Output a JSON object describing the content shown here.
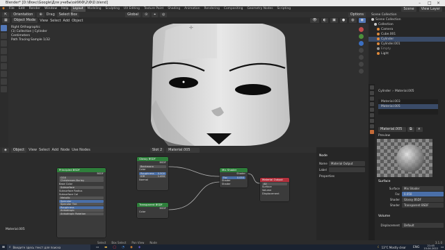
{
  "window": {
    "title": "Blender* [D:\\Фокс\\Google\\Для учебы\\ой96Ф\\2\\Ф\\D.blend]"
  },
  "menu": {
    "items": [
      "File",
      "Edit",
      "Render",
      "Window",
      "Help"
    ],
    "tabs": [
      "Layout",
      "Modeling",
      "Sculpting",
      "UV Editing",
      "Texture Paint",
      "Shading",
      "Animation",
      "Rendering",
      "Compositing",
      "Geometry Nodes",
      "Scripting"
    ],
    "active_tab": "Layout",
    "scene_label": "Scene",
    "view_layer_label": "View Layer"
  },
  "toolbar": {
    "mode": "Object Mode",
    "view": "View",
    "select": "Select",
    "add": "Add",
    "object": "Object",
    "orientation": "Orientation",
    "drag": "Drag",
    "select_box": "Select Box",
    "global": "Global",
    "options": "Options"
  },
  "viewport": {
    "info_lines": [
      "Right Orthographic",
      "(1) Collection | Cylinder",
      "Centimeters",
      "Path Tracing Sample 1/32"
    ]
  },
  "outliner": {
    "header": "Scene Collection",
    "items": [
      {
        "label": "Scene Collection",
        "color": "#cccccc"
      },
      {
        "label": "Collection",
        "color": "#cccccc"
      },
      {
        "label": "Camera",
        "color": "#e08b3c"
      },
      {
        "label": "Cube.001",
        "color": "#e08b3c"
      },
      {
        "label": "Cylinder",
        "color": "#e08b3c"
      },
      {
        "label": "Cylinder.001",
        "color": "#e08b3c"
      },
      {
        "label": "Empty",
        "color": "#999999"
      },
      {
        "label": "Light",
        "color": "#e08b3c"
      }
    ]
  },
  "properties": {
    "breadcrumb_object": "Cylinder",
    "breadcrumb_material": "Material.005",
    "material_slots": [
      "Material.003",
      "Material.005"
    ],
    "material_name": "Material.005",
    "preview_label": "Preview",
    "surface_header": "Surface",
    "rows": [
      {
        "label": "Surface",
        "value": "Mix Shader"
      },
      {
        "label": "Fac",
        "value": "0.050"
      },
      {
        "label": "Shader",
        "value": "Glossy BSDF"
      },
      {
        "label": "Shader",
        "value": "Transparent BSDF"
      }
    ],
    "volume_header": "Volume",
    "displacement_label": "Displacement",
    "displacement_value": "Default"
  },
  "node_editor": {
    "header": {
      "object": "Object",
      "view": "View",
      "select": "Select",
      "add": "Add",
      "node": "Node",
      "use_nodes": "Use Nodes",
      "slot": "Slot 2",
      "material": "Material.005"
    },
    "material_watermark": "Material.005",
    "nodes": {
      "principled": {
        "title": "Principled BSDF",
        "rows": [
          "GGX",
          "Christensen-Burley",
          "Base Color",
          "Subsurface",
          "Subsurface Radius",
          "Subsurface Col",
          "Metallic",
          "Specular",
          "Specular Tint",
          "Roughness",
          "Anisotropic",
          "Anisotropic Rotation"
        ],
        "output": "BSDF"
      },
      "glossy": {
        "title": "Glossy BSDF",
        "output": "BSDF",
        "rows": [
          "Beckmann",
          "Color",
          "Roughness",
          "IOR",
          "Normal"
        ],
        "roughness": "0.500",
        "ior": "1.450"
      },
      "transparent": {
        "title": "Transparent BSDF",
        "output": "BSDF",
        "rows": [
          "Color"
        ]
      },
      "mix": {
        "title": "Mix Shader",
        "output": "Shader",
        "rows": [
          "Fac",
          "Shader",
          "Shader"
        ],
        "fac": "0.050"
      },
      "output": {
        "title": "Material Output",
        "target": "All",
        "rows": [
          "Surface",
          "Volume",
          "Displacement"
        ]
      }
    }
  },
  "node_sidebar": {
    "header": "Node",
    "name_label": "Name",
    "name_value": "Material Output",
    "label_label": "Label",
    "properties_label": "Properties"
  },
  "statusbar": {
    "select": "Select",
    "box_select": "Box Select",
    "pan": "Pan View",
    "node": "Node",
    "version": "3.1.0"
  },
  "taskbar": {
    "search_placeholder": "Введите здесь текст для поиска",
    "weather": "13°C Mostly clear",
    "lang": "ENG",
    "time": "21:45",
    "date": "15.04.2022"
  },
  "colors": {
    "accent": "#c36a38",
    "node_green": "#2e7f3b",
    "node_red": "#b1303c",
    "selected_blue": "#5378b8"
  }
}
